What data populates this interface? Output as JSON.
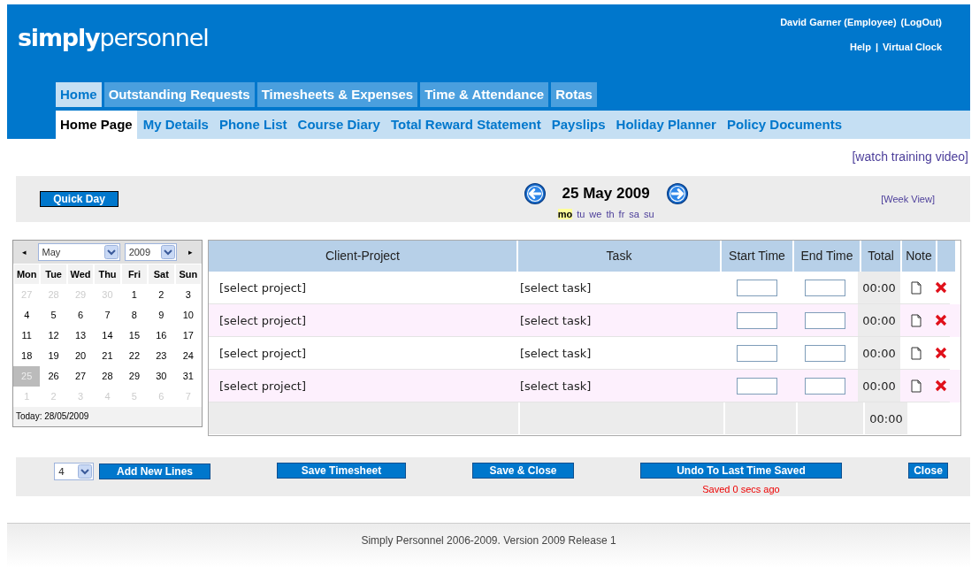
{
  "header": {
    "logo": "**simply**personnel",
    "user": "David Garner (Employee)",
    "logout": "(LogOut)",
    "help": "Help",
    "separator": "|",
    "virtual_clock": "Virtual Clock"
  },
  "tabs": [
    {
      "label": "Home",
      "selected": true
    },
    {
      "label": "Outstanding Requests",
      "selected": false
    },
    {
      "label": "Timesheets & Expenses",
      "selected": false
    },
    {
      "label": "Time & Attendance",
      "selected": false
    },
    {
      "label": "Rotas",
      "selected": false
    }
  ],
  "subtabs": [
    {
      "label": "Home Page",
      "selected": true
    },
    {
      "label": "My Details",
      "selected": false
    },
    {
      "label": "Phone List",
      "selected": false
    },
    {
      "label": "Course Diary",
      "selected": false
    },
    {
      "label": "Total Reward Statement",
      "selected": false
    },
    {
      "label": "Payslips",
      "selected": false
    },
    {
      "label": "Holiday Planner",
      "selected": false
    },
    {
      "label": "Policy Documents",
      "selected": false
    }
  ],
  "training_link": "[watch training video]",
  "day_bar": {
    "quick_day": "Quick Day",
    "date": "25 May 2009",
    "week_view": "[Week View]",
    "weekdays": [
      {
        "label": "mo",
        "selected": true
      },
      {
        "label": "tu",
        "selected": false
      },
      {
        "label": "we",
        "selected": false
      },
      {
        "label": "th",
        "selected": false
      },
      {
        "label": "fr",
        "selected": false
      },
      {
        "label": "sa",
        "selected": false
      },
      {
        "label": "su",
        "selected": false
      }
    ]
  },
  "calendar": {
    "prev": "◂",
    "month": "May",
    "year": "2009",
    "next": "▸",
    "day_names": [
      "Mon",
      "Tue",
      "Wed",
      "Thu",
      "Fri",
      "Sat",
      "Sun"
    ],
    "weeks": [
      [
        {
          "d": "27",
          "muted": true,
          "selected": false
        },
        {
          "d": "28",
          "muted": true,
          "selected": false
        },
        {
          "d": "29",
          "muted": true,
          "selected": false
        },
        {
          "d": "30",
          "muted": true,
          "selected": false
        },
        {
          "d": "1",
          "muted": false,
          "selected": false
        },
        {
          "d": "2",
          "muted": false,
          "selected": false
        },
        {
          "d": "3",
          "muted": false,
          "selected": false
        }
      ],
      [
        {
          "d": "4",
          "muted": false,
          "selected": false
        },
        {
          "d": "5",
          "muted": false,
          "selected": false
        },
        {
          "d": "6",
          "muted": false,
          "selected": false
        },
        {
          "d": "7",
          "muted": false,
          "selected": false
        },
        {
          "d": "8",
          "muted": false,
          "selected": false
        },
        {
          "d": "9",
          "muted": false,
          "selected": false
        },
        {
          "d": "10",
          "muted": false,
          "selected": false
        }
      ],
      [
        {
          "d": "11",
          "muted": false,
          "selected": false
        },
        {
          "d": "12",
          "muted": false,
          "selected": false
        },
        {
          "d": "13",
          "muted": false,
          "selected": false
        },
        {
          "d": "14",
          "muted": false,
          "selected": false
        },
        {
          "d": "15",
          "muted": false,
          "selected": false
        },
        {
          "d": "16",
          "muted": false,
          "selected": false
        },
        {
          "d": "17",
          "muted": false,
          "selected": false
        }
      ],
      [
        {
          "d": "18",
          "muted": false,
          "selected": false
        },
        {
          "d": "19",
          "muted": false,
          "selected": false
        },
        {
          "d": "20",
          "muted": false,
          "selected": false
        },
        {
          "d": "21",
          "muted": false,
          "selected": false
        },
        {
          "d": "22",
          "muted": false,
          "selected": false
        },
        {
          "d": "23",
          "muted": false,
          "selected": false
        },
        {
          "d": "24",
          "muted": false,
          "selected": false
        }
      ],
      [
        {
          "d": "25",
          "muted": false,
          "selected": true
        },
        {
          "d": "26",
          "muted": false,
          "selected": false
        },
        {
          "d": "27",
          "muted": false,
          "selected": false
        },
        {
          "d": "28",
          "muted": false,
          "selected": false
        },
        {
          "d": "29",
          "muted": false,
          "selected": false
        },
        {
          "d": "30",
          "muted": false,
          "selected": false
        },
        {
          "d": "31",
          "muted": false,
          "selected": false
        }
      ],
      [
        {
          "d": "1",
          "muted": true,
          "selected": false
        },
        {
          "d": "2",
          "muted": true,
          "selected": false
        },
        {
          "d": "3",
          "muted": true,
          "selected": false
        },
        {
          "d": "4",
          "muted": true,
          "selected": false
        },
        {
          "d": "5",
          "muted": true,
          "selected": false
        },
        {
          "d": "6",
          "muted": true,
          "selected": false
        },
        {
          "d": "7",
          "muted": true,
          "selected": false
        }
      ]
    ],
    "today": "Today: 28/05/2009"
  },
  "table": {
    "columns": [
      "Client-Project",
      "Task",
      "Start Time",
      "End Time",
      "Total",
      "Note"
    ],
    "rows": [
      {
        "project": "[select project]",
        "task": "[select task]",
        "total": "00:00"
      },
      {
        "project": "[select project]",
        "task": "[select task]",
        "total": "00:00"
      },
      {
        "project": "[select project]",
        "task": "[select task]",
        "total": "00:00"
      },
      {
        "project": "[select project]",
        "task": "[select task]",
        "total": "00:00"
      }
    ],
    "grand_total": "00:00"
  },
  "actions": {
    "line_count": "4",
    "add_lines": "Add New Lines",
    "save": "Save Timesheet",
    "save_close": "Save & Close",
    "undo": "Undo To Last Time Saved",
    "saved_status": "Saved 0 secs ago",
    "close": "Close"
  },
  "footer": "Simply Personnel 2006-2009. Version 2009 Release 1"
}
